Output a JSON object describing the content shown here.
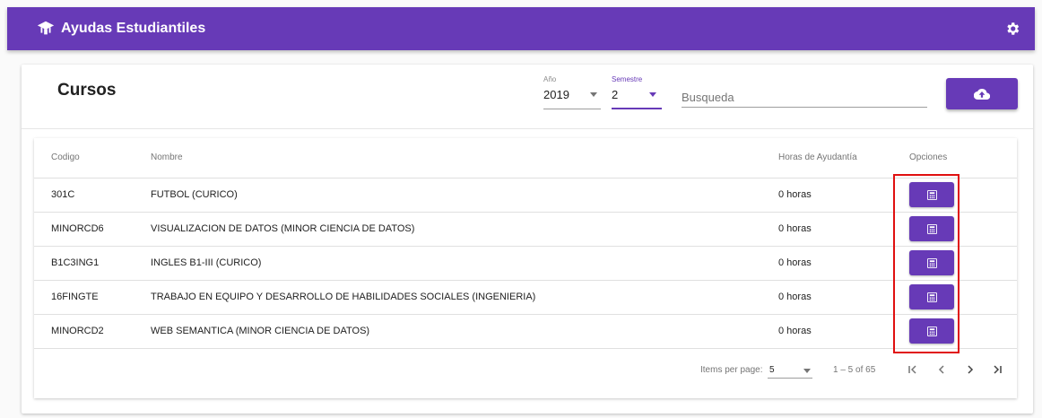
{
  "app": {
    "title": "Ayudas Estudiantiles",
    "logo_icon": "graduation-cap-icon",
    "settings_icon": "gear-icon"
  },
  "header": {
    "title": "Cursos",
    "year": {
      "label": "Año",
      "value": "2019"
    },
    "semester": {
      "label": "Semestre",
      "value": "2"
    },
    "search": {
      "placeholder": "Busqueda",
      "value": ""
    },
    "upload_icon": "cloud-upload-icon"
  },
  "table": {
    "columns": [
      "Codigo",
      "Nombre",
      "Horas de Ayudantía",
      "Opciones"
    ],
    "rows": [
      {
        "code": "301C",
        "name": "FUTBOL (CURICO)",
        "hours": "0 horas"
      },
      {
        "code": "MINORCD6",
        "name": "VISUALIZACION DE DATOS (MINOR CIENCIA DE DATOS)",
        "hours": "0 horas"
      },
      {
        "code": "B1C3ING1",
        "name": "INGLES B1-III (CURICO)",
        "hours": "0 horas"
      },
      {
        "code": "16FINGTE",
        "name": "TRABAJO EN EQUIPO Y DESARROLLO DE HABILIDADES SOCIALES (INGENIERIA)",
        "hours": "0 horas"
      },
      {
        "code": "MINORCD2",
        "name": "WEB SEMANTICA (MINOR CIENCIA DE DATOS)",
        "hours": "0 horas"
      }
    ],
    "row_button_icon": "calculator-icon"
  },
  "paginator": {
    "label": "Items per page:",
    "page_size": "5",
    "range": "1 – 5 of 65",
    "first_icon": "first-page-icon",
    "prev_icon": "chevron-left-icon",
    "next_icon": "chevron-right-icon",
    "last_icon": "last-page-icon"
  },
  "colors": {
    "primary": "#673ab7",
    "highlight": "#e01010"
  }
}
